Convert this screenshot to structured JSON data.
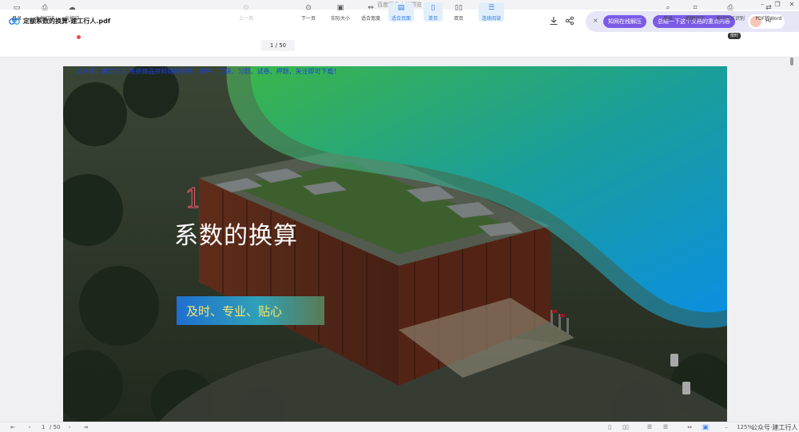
{
  "window": {
    "title": "百度网盘文档预览",
    "minimize": "–",
    "restore": "❐",
    "close": "✕"
  },
  "header": {
    "file_name": "定额系数的换算-建工行人.pdf",
    "download_icon": "download-icon",
    "share_icon": "share-icon"
  },
  "ai_bar": {
    "close": "×",
    "pill1": "知网在线解压",
    "pill2": "总结一下这个文档的重点内容",
    "hi": "Hi"
  },
  "toolbar": {
    "toc": "目录",
    "local_print": "本地打印",
    "cloud_print": "云打印",
    "prev_page": "上一页",
    "page_current": "1",
    "page_sep": "/",
    "page_total": "50",
    "next_page": "下一页",
    "actual_size": "实际大小",
    "fit_width": "适合宽度",
    "fit_page": "适合页面",
    "single_page": "单页",
    "double_page": "双页",
    "continuous": "连续阅读",
    "search": "查找",
    "screenshot_ocr": "截图识字",
    "pdf_print": "影印PDF识别",
    "pdf_to_word": "PDF转Word",
    "hot_tag": "限时"
  },
  "slide": {
    "top_note": "公众号：建工行人  免费精品资料随时更新、课件、口诀、习题、试卷、押题，关注即可下载！",
    "section_number": "1",
    "section_title": "系数的换算",
    "tagline": "及时、专业、贴心"
  },
  "statusbar": {
    "page_current": "1",
    "page_total": "/ 50",
    "zoom": "125%",
    "watermark": "公众号·建工行人"
  },
  "colors": {
    "accent": "#2f7be5",
    "ai_purple": "#7a5ae6",
    "wave_green": "#3bb54a",
    "wave_blue": "#0b8fe0"
  }
}
